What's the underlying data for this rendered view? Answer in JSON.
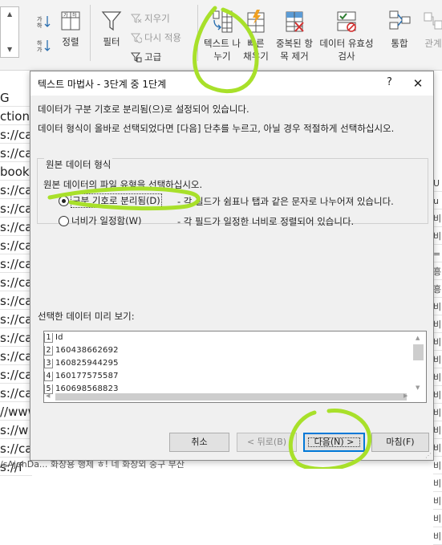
{
  "ribbon": {
    "sort_label": "정렬",
    "filter_label": "필터",
    "clear_label": "지우기",
    "reapply_label": "다시 적용",
    "advanced_label": "고급",
    "text_to_columns_label": "텍스트 나누기",
    "flash_fill_label": "빠른 채우기",
    "remove_duplicates_label": "중복된 항목 제거",
    "data_validation_label": "데이터 유효성 검사",
    "consolidate_label": "통합",
    "relationships_label": "관계"
  },
  "sheet": {
    "left_cells": [
      "G",
      "ction U",
      "s://ca",
      "s://ca",
      "book",
      "s://ca",
      "s://ca",
      "s://ca",
      "s://ca",
      "s://ca",
      "s://ca",
      "s://ca",
      "s://ca",
      "s://ca",
      "s://ca",
      "s://ca",
      "s://ca",
      "//www",
      "s://w",
      "s://ca",
      "s://f"
    ],
    "right_cells": [
      "U",
      "u",
      "비",
      "비",
      "=",
      "흥",
      "흥",
      "비",
      "비",
      "비",
      "비",
      "비",
      "비",
      "비",
      "비",
      "비",
      "비",
      "비",
      "비",
      "비",
      "비"
    ],
    "bottom_text": "/sAjohDa...  화장용 행제  ㅎ! 네 화장외 중구 부산"
  },
  "dialog": {
    "title": "텍스트 마법사 - 3단계 중 1단계",
    "help": "?",
    "close": "✕",
    "intro_line1": "데이터가 구분 기호로 분리됨(으)로 설정되어 있습니다.",
    "intro_line2": "데이터 형식이 올바로 선택되었다면 [다음] 단추를 누르고, 아닐 경우 적절하게 선택하십시오.",
    "group_title": "원본 데이터 형식",
    "group_subtitle": "원본 데이터의 파일 유형을 선택하십시오.",
    "option_delimited_label": "구분 기호로 분리됨(D)",
    "option_delimited_desc": "- 각 필드가 쉼표나 탭과 같은 문자로 나누어져 있습니다.",
    "option_fixed_label": "너비가 일정함(W)",
    "option_fixed_desc": "- 각 필드가 일정한 너비로 정렬되어 있습니다.",
    "selected_option": "delimited",
    "preview_label": "선택한 데이터 미리 보기:",
    "preview_rows": [
      {
        "num": "1",
        "value": "Id"
      },
      {
        "num": "2",
        "value": "160438662692"
      },
      {
        "num": "3",
        "value": "160825944295"
      },
      {
        "num": "4",
        "value": "160177575587"
      },
      {
        "num": "5",
        "value": "160698568823"
      }
    ],
    "buttons": {
      "cancel": "취소",
      "back": "< 뒤로(B)",
      "next": "다음(N) >",
      "finish": "마침(F)"
    }
  },
  "colors": {
    "annotation": "#a8e02a",
    "accent": "#0078d7",
    "ribbon_bg": "#f3f3f3",
    "dialog_bg": "#f0f0f0"
  }
}
